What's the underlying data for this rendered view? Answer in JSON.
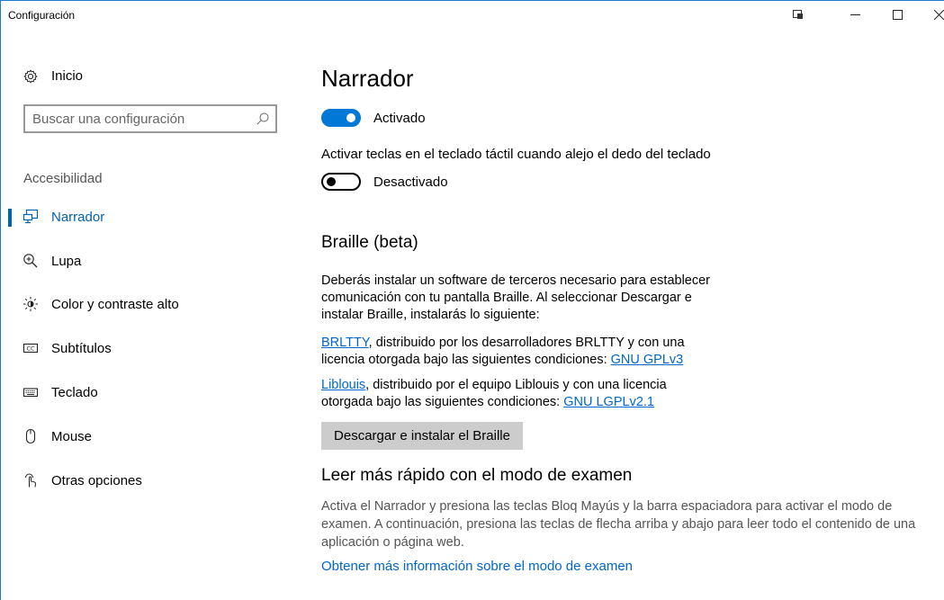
{
  "window": {
    "title": "Configuración"
  },
  "sidebar": {
    "home_label": "Inicio",
    "search_placeholder": "Buscar una configuración",
    "section_label": "Accesibilidad",
    "items": [
      {
        "label": "Narrador",
        "icon": "narrator-icon",
        "active": true
      },
      {
        "label": "Lupa",
        "icon": "magnifier-icon",
        "active": false
      },
      {
        "label": "Color y contraste alto",
        "icon": "brightness-icon",
        "active": false
      },
      {
        "label": "Subtítulos",
        "icon": "closed-captions-icon",
        "active": false
      },
      {
        "label": "Teclado",
        "icon": "keyboard-icon",
        "active": false
      },
      {
        "label": "Mouse",
        "icon": "mouse-icon",
        "active": false
      },
      {
        "label": "Otras opciones",
        "icon": "touch-icon",
        "active": false
      }
    ]
  },
  "main": {
    "title": "Narrador",
    "narrator_toggle": {
      "state": "on",
      "label": "Activado"
    },
    "touch_keyboard_desc": "Activar teclas en el teclado táctil cuando alejo el dedo del teclado",
    "touch_keyboard_toggle": {
      "state": "off",
      "label": "Desactivado"
    },
    "braille": {
      "heading": "Braille (beta)",
      "intro_line1": "Deberás instalar un software de terceros necesario para establecer",
      "intro_line2": "comunicación con tu pantalla Braille. Al seleccionar Descargar e",
      "intro_line3": "instalar Braille, instalarás lo siguiente:",
      "brltty_link": "BRLTTY",
      "brltty_text1": ", distribuido por los desarrolladores BRLTTY y con una",
      "brltty_text2": "licencia otorgada bajo las siguientes condiciones: ",
      "brltty_license": "GNU GPLv3",
      "liblouis_link": "Liblouis",
      "liblouis_text1": ", distribuido por el equipo Liblouis y con una licencia",
      "liblouis_text2": "otorgada bajo las siguientes condiciones: ",
      "liblouis_license": "GNU LGPLv2.1",
      "install_button": "Descargar e instalar el Braille"
    },
    "scan_mode": {
      "heading": "Leer más rápido con el modo de examen",
      "description": "Activa el Narrador y presiona las teclas Bloq Mayús y la barra espaciadora para activar el modo de examen. A continuación, presiona las teclas de flecha arriba y abajo para leer todo el contenido de una aplicación o página web.",
      "link": "Obtener más información sobre el modo de examen"
    }
  },
  "colors": {
    "accent": "#0078d7",
    "link": "#0066cc",
    "window_border": "#1e7bd2"
  }
}
